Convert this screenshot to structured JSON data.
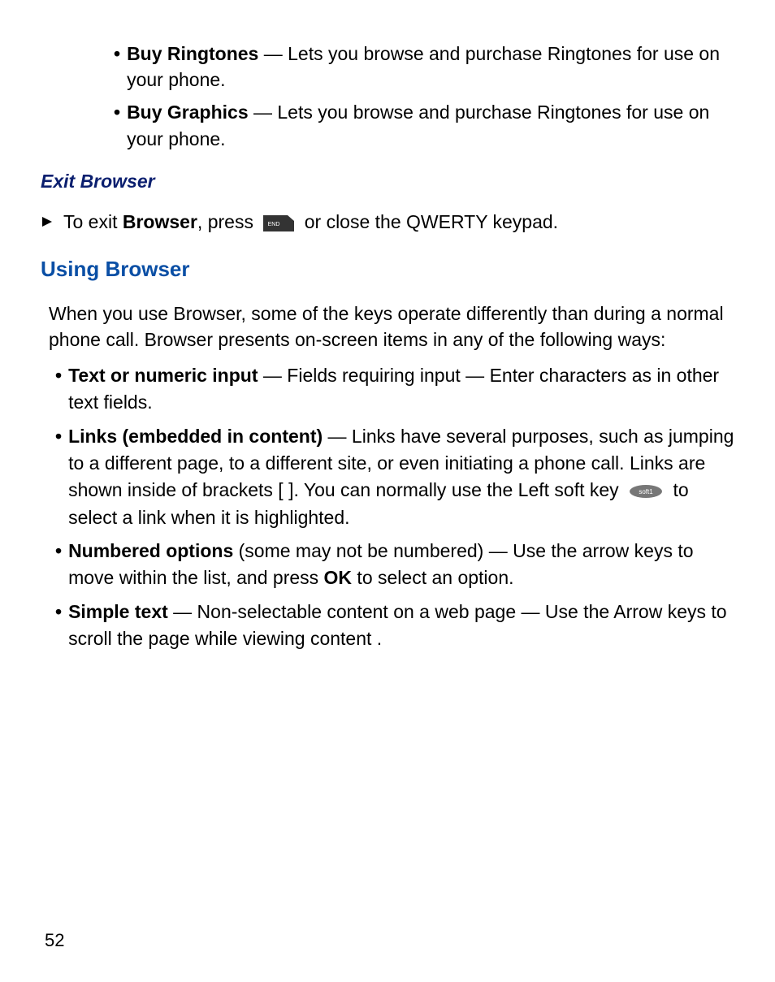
{
  "innerBullets": [
    {
      "label": "Buy Ringtones",
      "text": " — Lets you browse and purchase Ringtones for use on your phone."
    },
    {
      "label": "Buy Graphics",
      "text": " — Lets you browse and purchase Ringtones for use on your phone."
    }
  ],
  "exitBrowserHeading": "Exit Browser",
  "exitStep": {
    "pre": "To exit ",
    "bold1": "Browser",
    "mid": ", press ",
    "post": " or close the QWERTY keypad."
  },
  "usingBrowserHeading": "Using Browser",
  "bodyText": "When you use Browser, some of the keys operate differently than during a normal phone call. Browser presents on-screen items in any of the following ways:",
  "outerBullets": {
    "b1": {
      "label": "Text or numeric input",
      "text": " — Fields requiring input — Enter characters as in other text fields."
    },
    "b2": {
      "label": "Links (embedded in content)",
      "text1": " — Links have several purposes, such as jumping to a different page, to a different site, or even initiating a phone call. Links are shown inside of brackets [  ]. You can normally use the Left soft key ",
      "text2": " to select a link when it is highlighted."
    },
    "b3": {
      "label": "Numbered options",
      "text1": " (some may not be numbered) — Use the arrow keys to move within the list, and press ",
      "bold2": "OK",
      "text2": " to select an option."
    },
    "b4": {
      "label": "Simple text",
      "text": " — Non-selectable content on a web page — Use the Arrow keys to scroll the page while viewing content ."
    }
  },
  "pageNumber": "52"
}
